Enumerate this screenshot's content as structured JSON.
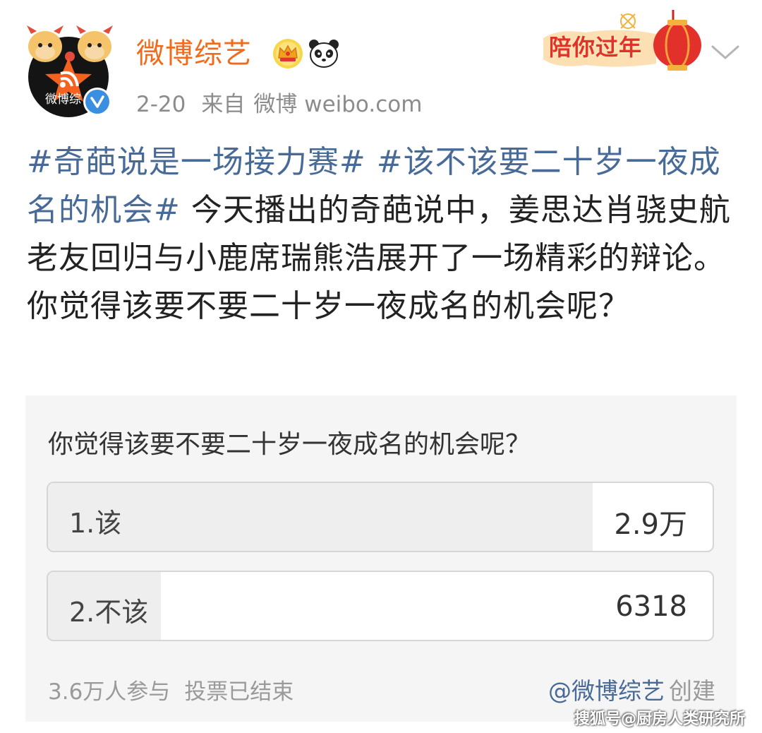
{
  "header": {
    "username": "微博综艺",
    "avatar_text": "微博综",
    "date": "2-20",
    "source_prefix": "来自",
    "source": "微博 weibo.com",
    "festive_banner": "陪你过年",
    "icons": [
      "crown-icon",
      "panda-icon",
      "chevron-down-icon",
      "verified-icon"
    ]
  },
  "post": {
    "topic1": "#奇葩说是一场接力赛#",
    "topic2": "#该不该要二十岁一夜成名的机会#",
    "body": " 今天播出的奇葩说中，姜思达肖骁史航老友回归与小鹿席瑞熊浩展开了一场精彩的辩论。你觉得该要不要二十岁一夜成名的机会呢？"
  },
  "poll": {
    "question": "你觉得该要不要二十岁一夜成名的机会呢？",
    "options": [
      {
        "label": "1.该",
        "count": "2.9万",
        "share": 0.82
      },
      {
        "label": "2.不该",
        "count": "6318",
        "share": 0.17
      }
    ],
    "participants": "3.6万人参与",
    "status": "投票已结束",
    "creator_link": "@微博综艺",
    "creator_suffix": "创建"
  },
  "watermark": "搜狐号@厨房人类研究所",
  "colors": {
    "username": "#f16b1c",
    "topic": "#476a97",
    "verified": "#3b8fe0",
    "poll_bg": "#f5f5f5",
    "option_fill": "#eeeeee"
  }
}
